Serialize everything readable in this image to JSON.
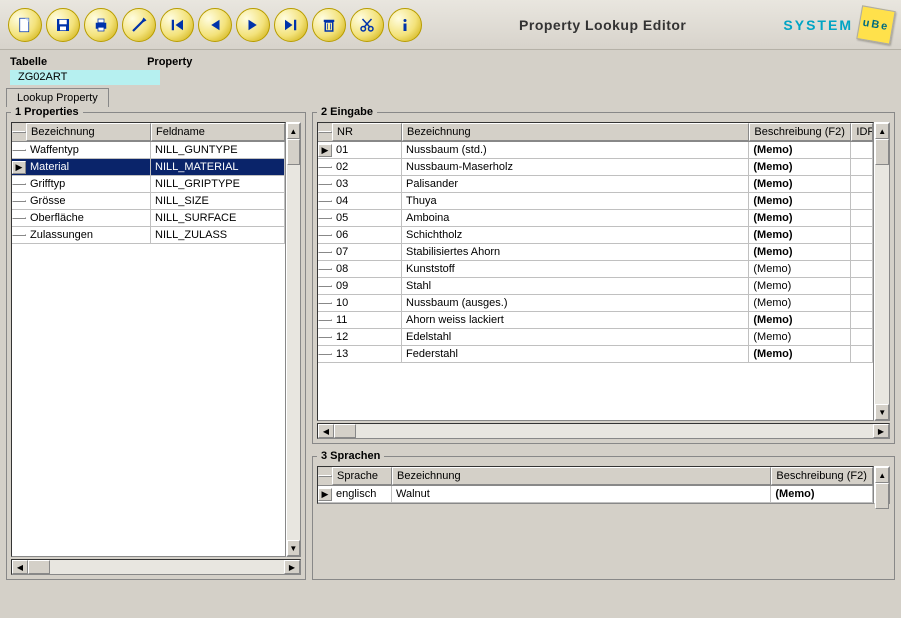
{
  "app": {
    "title": "Property Lookup Editor",
    "brand": "SYSTEM",
    "brand_logo_text": "uBe"
  },
  "toolbar": [
    {
      "name": "new-icon"
    },
    {
      "name": "save-icon"
    },
    {
      "name": "print-icon"
    },
    {
      "name": "refresh-icon"
    },
    {
      "name": "first-icon"
    },
    {
      "name": "prev-icon"
    },
    {
      "name": "next-icon"
    },
    {
      "name": "last-icon"
    },
    {
      "name": "delete-icon"
    },
    {
      "name": "cut-icon"
    },
    {
      "name": "info-icon"
    }
  ],
  "header": {
    "label_table": "Tabelle",
    "value_table": "ZG02ART",
    "label_property": "Property"
  },
  "tab": {
    "label": "Lookup Property"
  },
  "panels": {
    "properties": {
      "legend": "1 Properties",
      "columns": {
        "bez": "Bezeichnung",
        "fld": "Feldname"
      },
      "rows": [
        {
          "bez": "Waffentyp",
          "fld": "NILL_GUNTYPE",
          "selected": false
        },
        {
          "bez": "Material",
          "fld": "NILL_MATERIAL",
          "selected": true
        },
        {
          "bez": "Grifftyp",
          "fld": "NILL_GRIPTYPE",
          "selected": false
        },
        {
          "bez": "Grösse",
          "fld": "NILL_SIZE",
          "selected": false
        },
        {
          "bez": "Oberfläche",
          "fld": "NILL_SURFACE",
          "selected": false
        },
        {
          "bez": "Zulassungen",
          "fld": "NILL_ZULASS",
          "selected": false
        }
      ]
    },
    "eingabe": {
      "legend": "2 Eingabe",
      "columns": {
        "nr": "NR",
        "bez": "Bezeichnung",
        "desc": "Beschreibung (F2)",
        "idf": "IDF"
      },
      "rows": [
        {
          "nr": "01",
          "bez": "Nussbaum (std.)",
          "memo": "(Memo)",
          "bold": true,
          "current": true
        },
        {
          "nr": "02",
          "bez": "Nussbaum-Maserholz",
          "memo": "(Memo)",
          "bold": true
        },
        {
          "nr": "03",
          "bez": "Palisander",
          "memo": "(Memo)",
          "bold": true
        },
        {
          "nr": "04",
          "bez": "Thuya",
          "memo": "(Memo)",
          "bold": true
        },
        {
          "nr": "05",
          "bez": "Amboina",
          "memo": "(Memo)",
          "bold": true
        },
        {
          "nr": "06",
          "bez": "Schichtholz",
          "memo": "(Memo)",
          "bold": true
        },
        {
          "nr": "07",
          "bez": "Stabilisiertes Ahorn",
          "memo": "(Memo)",
          "bold": true
        },
        {
          "nr": "08",
          "bez": "Kunststoff",
          "memo": "(Memo)",
          "bold": false
        },
        {
          "nr": "09",
          "bez": "Stahl",
          "memo": "(Memo)",
          "bold": false
        },
        {
          "nr": "10",
          "bez": "Nussbaum (ausges.)",
          "memo": "(Memo)",
          "bold": false
        },
        {
          "nr": "11",
          "bez": "Ahorn weiss lackiert",
          "memo": "(Memo)",
          "bold": true
        },
        {
          "nr": "12",
          "bez": "Edelstahl",
          "memo": "(Memo)",
          "bold": false
        },
        {
          "nr": "13",
          "bez": "Federstahl",
          "memo": "(Memo)",
          "bold": true
        }
      ]
    },
    "sprachen": {
      "legend": "3 Sprachen",
      "columns": {
        "spr": "Sprache",
        "bez": "Bezeichnung",
        "desc": "Beschreibung (F2)"
      },
      "rows": [
        {
          "spr": "englisch",
          "bez": "Walnut",
          "memo": "(Memo)",
          "bold": true,
          "current": true
        }
      ]
    }
  }
}
